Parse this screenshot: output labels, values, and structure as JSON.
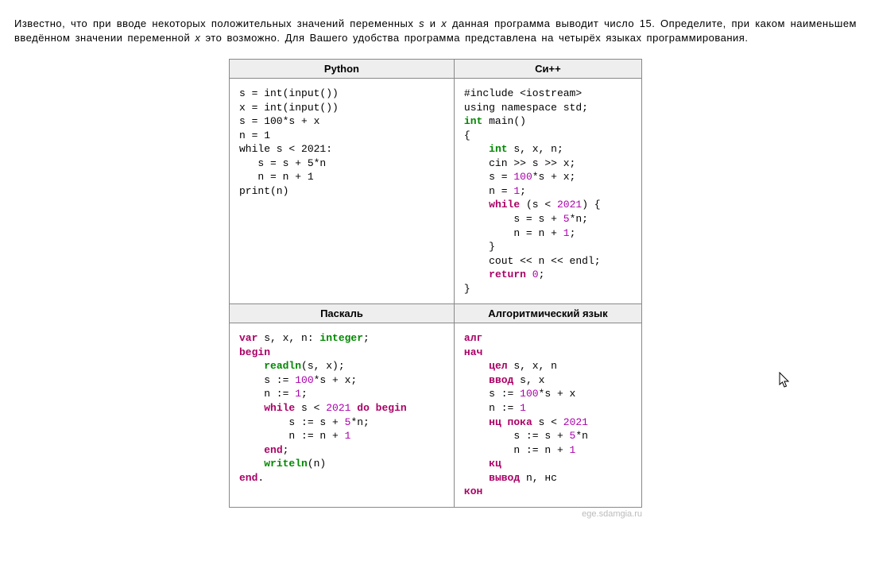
{
  "problem": {
    "line1_a": "Известно, что при вводе некоторых положительных значений переменных ",
    "var_s": "s",
    "line1_b": " и ",
    "var_x": "x",
    "line1_c": " данная программа выводит число 15. Определите, при каком наименьшем введённом значении переменной ",
    "var_x2": "x",
    "line1_d": " это возможно. Для Вашего удобства программа представлена на четырёх языках программирования."
  },
  "headers": {
    "python": "Python",
    "cpp": "Си++",
    "pascal": "Паскаль",
    "alg": "Алгоритмический язык"
  },
  "code": {
    "python": [
      {
        "t": "s = int(input())"
      },
      {
        "t": "x = int(input())"
      },
      {
        "t": "s = 100*s + x"
      },
      {
        "t": "n = 1"
      },
      {
        "t": "while s < 2021:"
      },
      {
        "t": "   s = s + 5*n"
      },
      {
        "t": "   n = n + 1"
      },
      {
        "t": "print(n)"
      }
    ],
    "cpp": [
      [
        {
          "t": "#include <iostream>"
        }
      ],
      [
        {
          "t": "using namespace std;"
        }
      ],
      [
        {
          "c": "typ",
          "t": "int"
        },
        {
          "t": " main()"
        }
      ],
      [
        {
          "t": "{"
        }
      ],
      [
        {
          "t": "    "
        },
        {
          "c": "typ",
          "t": "int"
        },
        {
          "t": " s, x, n;"
        }
      ],
      [
        {
          "t": "    cin >> s >> x;"
        }
      ],
      [
        {
          "t": "    s = "
        },
        {
          "c": "num",
          "t": "100"
        },
        {
          "t": "*s + x;"
        }
      ],
      [
        {
          "t": "    n = "
        },
        {
          "c": "num",
          "t": "1"
        },
        {
          "t": ";"
        }
      ],
      [
        {
          "t": "    "
        },
        {
          "c": "kw",
          "t": "while"
        },
        {
          "t": " (s < "
        },
        {
          "c": "num",
          "t": "2021"
        },
        {
          "t": ") {"
        }
      ],
      [
        {
          "t": "        s = s + "
        },
        {
          "c": "num",
          "t": "5"
        },
        {
          "t": "*n;"
        }
      ],
      [
        {
          "t": "        n = n + "
        },
        {
          "c": "num",
          "t": "1"
        },
        {
          "t": ";"
        }
      ],
      [
        {
          "t": "    }"
        }
      ],
      [
        {
          "t": "    cout << n << endl;"
        }
      ],
      [
        {
          "t": "    "
        },
        {
          "c": "kw",
          "t": "return"
        },
        {
          "t": " "
        },
        {
          "c": "num",
          "t": "0"
        },
        {
          "t": ";"
        }
      ],
      [
        {
          "t": "}"
        }
      ]
    ],
    "pascal": [
      [
        {
          "c": "kw",
          "t": "var"
        },
        {
          "t": " s, x, n: "
        },
        {
          "c": "typ",
          "t": "integer"
        },
        {
          "t": ";"
        }
      ],
      [
        {
          "c": "kw",
          "t": "begin"
        }
      ],
      [
        {
          "t": "    "
        },
        {
          "c": "fn",
          "t": "readln"
        },
        {
          "t": "(s, x);"
        }
      ],
      [
        {
          "t": "    s := "
        },
        {
          "c": "num",
          "t": "100"
        },
        {
          "t": "*s + x;"
        }
      ],
      [
        {
          "t": "    n := "
        },
        {
          "c": "num",
          "t": "1"
        },
        {
          "t": ";"
        }
      ],
      [
        {
          "t": "    "
        },
        {
          "c": "kw",
          "t": "while"
        },
        {
          "t": " s < "
        },
        {
          "c": "num",
          "t": "2021"
        },
        {
          "t": " "
        },
        {
          "c": "kw",
          "t": "do begin"
        }
      ],
      [
        {
          "t": "        s := s + "
        },
        {
          "c": "num",
          "t": "5"
        },
        {
          "t": "*n;"
        }
      ],
      [
        {
          "t": "        n := n + "
        },
        {
          "c": "num",
          "t": "1"
        }
      ],
      [
        {
          "t": "    "
        },
        {
          "c": "kw",
          "t": "end"
        },
        {
          "t": ";"
        }
      ],
      [
        {
          "t": "    "
        },
        {
          "c": "fn",
          "t": "writeln"
        },
        {
          "t": "(n)"
        }
      ],
      [
        {
          "c": "kw",
          "t": "end"
        },
        {
          "t": "."
        }
      ]
    ],
    "alg": [
      [
        {
          "c": "kw",
          "t": "алг"
        }
      ],
      [
        {
          "c": "kw",
          "t": "нач"
        }
      ],
      [
        {
          "t": "    "
        },
        {
          "c": "kw",
          "t": "цел"
        },
        {
          "t": " s, x, n"
        }
      ],
      [
        {
          "t": "    "
        },
        {
          "c": "kw",
          "t": "ввод"
        },
        {
          "t": " s, x"
        }
      ],
      [
        {
          "t": "    s := "
        },
        {
          "c": "num",
          "t": "100"
        },
        {
          "t": "*s + x"
        }
      ],
      [
        {
          "t": "    n := "
        },
        {
          "c": "num",
          "t": "1"
        }
      ],
      [
        {
          "t": "    "
        },
        {
          "c": "kw",
          "t": "нц пока"
        },
        {
          "t": " s < "
        },
        {
          "c": "num",
          "t": "2021"
        }
      ],
      [
        {
          "t": "        s := s + "
        },
        {
          "c": "num",
          "t": "5"
        },
        {
          "t": "*n"
        }
      ],
      [
        {
          "t": "        n := n + "
        },
        {
          "c": "num",
          "t": "1"
        }
      ],
      [
        {
          "t": "    "
        },
        {
          "c": "kw",
          "t": "кц"
        }
      ],
      [
        {
          "t": "    "
        },
        {
          "c": "kw",
          "t": "вывод"
        },
        {
          "t": " n, нс"
        }
      ],
      [
        {
          "c": "kw",
          "t": "кон"
        }
      ]
    ]
  },
  "footer": "ege.sdamgia.ru"
}
